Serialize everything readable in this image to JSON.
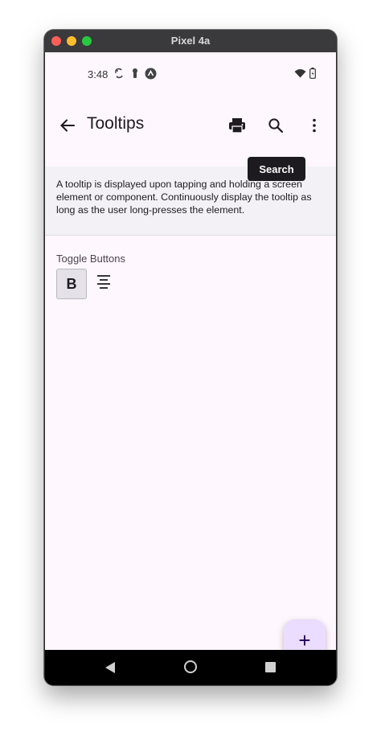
{
  "window": {
    "title": "Pixel 4a"
  },
  "statusbar": {
    "time": "3:48",
    "icons": [
      "sync-icon",
      "keyhole-icon",
      "android-badge-icon",
      "wifi-icon",
      "battery-icon"
    ]
  },
  "appbar": {
    "title": "Tooltips",
    "actions": [
      "back-arrow-icon",
      "print-icon",
      "search-icon",
      "more-vert-icon"
    ]
  },
  "tooltip": {
    "text": "Search"
  },
  "description": {
    "text": "A tooltip is displayed upon tapping and holding a screen element or component. Continuously display the tooltip as long as the user long-presses the element."
  },
  "toggle_section": {
    "label": "Toggle Buttons",
    "bold_label": "B",
    "buttons": [
      "bold-toggle",
      "align-center-icon"
    ]
  },
  "fab": {
    "icon": "plus-icon",
    "symbol": "+"
  },
  "navbar": {
    "icons": [
      "back-triangle-icon",
      "home-circle-icon",
      "recents-square-icon"
    ]
  },
  "colors": {
    "screen_bg": "#fef7fd",
    "description_bg": "#f3f1f5",
    "tooltip_bg": "#1d1b20",
    "fab_bg": "#eaddff",
    "navbar_bg": "#000000"
  }
}
